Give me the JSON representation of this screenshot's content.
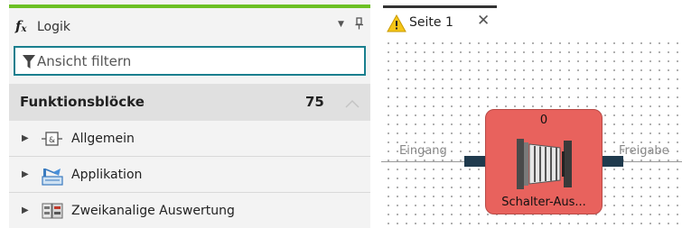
{
  "panel": {
    "icon": "function-icon",
    "fx_glyph": "f",
    "fx_sub": "x",
    "title": "Logik",
    "menu_icon": "dropdown-arrow-icon",
    "pin_icon": "pin-icon"
  },
  "search": {
    "icon": "filter-icon",
    "placeholder": "Ansicht filtern",
    "value": ""
  },
  "category": {
    "title": "Funktionsblöcke",
    "count": "75",
    "collapse_icon": "chevron-up-icon"
  },
  "tree_items": [
    {
      "label": "Allgemein",
      "icon": "general-block-icon"
    },
    {
      "label": "Applikation",
      "icon": "application-icon"
    },
    {
      "label": "Zweikanalige Auswertung",
      "icon": "dual-channel-icon"
    }
  ],
  "tab": {
    "label": "Seite 1",
    "icon": "warning-icon",
    "close_icon": "close-icon"
  },
  "canvas": {
    "input_label": "Eingang",
    "output_label": "Freigabe",
    "block": {
      "counter": "0",
      "name": "Schalter-Aus...",
      "icon": "door-switch-icon"
    }
  },
  "colors": {
    "accent": "#6cc024",
    "search_border": "#1a7f8e",
    "block_fill": "#e8625d",
    "pin": "#1f3a4d"
  }
}
